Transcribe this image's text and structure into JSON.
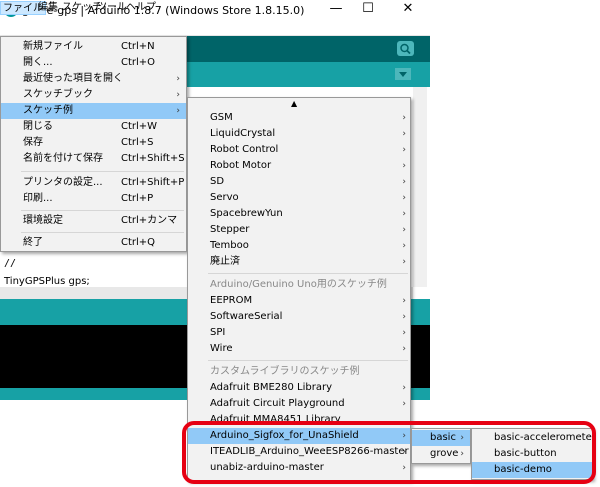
{
  "window": {
    "title": "grove-gps | Arduino 1.8.7 (Windows Store 1.8.15.0)",
    "minimize": "—",
    "maximize": "☐",
    "close": "✕"
  },
  "menubar": [
    "ファイル",
    "編集",
    "スケッチ",
    "ツール",
    "ヘルプ"
  ],
  "editor": {
    "comment": "//",
    "code_line": "TinyGPSPlus gps;"
  },
  "file_menu": [
    {
      "label": "新規ファイル",
      "shortcut": "Ctrl+N"
    },
    {
      "label": "開く...",
      "shortcut": "Ctrl+O"
    },
    {
      "label": "最近使った項目を開く",
      "shortcut": "",
      "submenu": true
    },
    {
      "label": "スケッチブック",
      "shortcut": "",
      "submenu": true
    },
    {
      "label": "スケッチ例",
      "shortcut": "",
      "submenu": true,
      "highlighted": true
    },
    {
      "label": "閉じる",
      "shortcut": "Ctrl+W"
    },
    {
      "label": "保存",
      "shortcut": "Ctrl+S"
    },
    {
      "label": "名前を付けて保存",
      "shortcut": "Ctrl+Shift+S"
    },
    {
      "label": "プリンタの設定...",
      "shortcut": "Ctrl+Shift+P"
    },
    {
      "label": "印刷...",
      "shortcut": "Ctrl+P"
    },
    {
      "label": "環境設定",
      "shortcut": "Ctrl+カンマ"
    },
    {
      "label": "終了",
      "shortcut": "Ctrl+Q"
    }
  ],
  "examples_menu": {
    "scroll_up": "▲",
    "builtin": [
      "GSM",
      "LiquidCrystal",
      "Robot Control",
      "Robot Motor",
      "SD",
      "Servo",
      "SpacebrewYun",
      "Stepper",
      "Temboo",
      "廃止済"
    ],
    "uno_header": "Arduino/Genuino Uno用のスケッチ例",
    "uno": [
      "EEPROM",
      "SoftwareSerial",
      "SPI",
      "Wire"
    ],
    "custom_header": "カスタムライブラリのスケッチ例",
    "custom": [
      "Adafruit BME280 Library",
      "Adafruit Circuit Playground",
      "Adafruit MMA8451 Library",
      "Arduino_Sigfox_for_UnaShield",
      "ITEADLIB_Arduino_WeeESP8266-master",
      "unabiz-arduino-master"
    ]
  },
  "sigfox_submenu": [
    "basic",
    "grove"
  ],
  "basic_submenu": [
    "basic-accelerometer",
    "basic-button",
    "basic-demo"
  ],
  "colors": {
    "teal_dark": "#006468",
    "teal": "#17a1a5",
    "menu_highlight": "#91c9f7",
    "callout_red": "#e60012"
  }
}
